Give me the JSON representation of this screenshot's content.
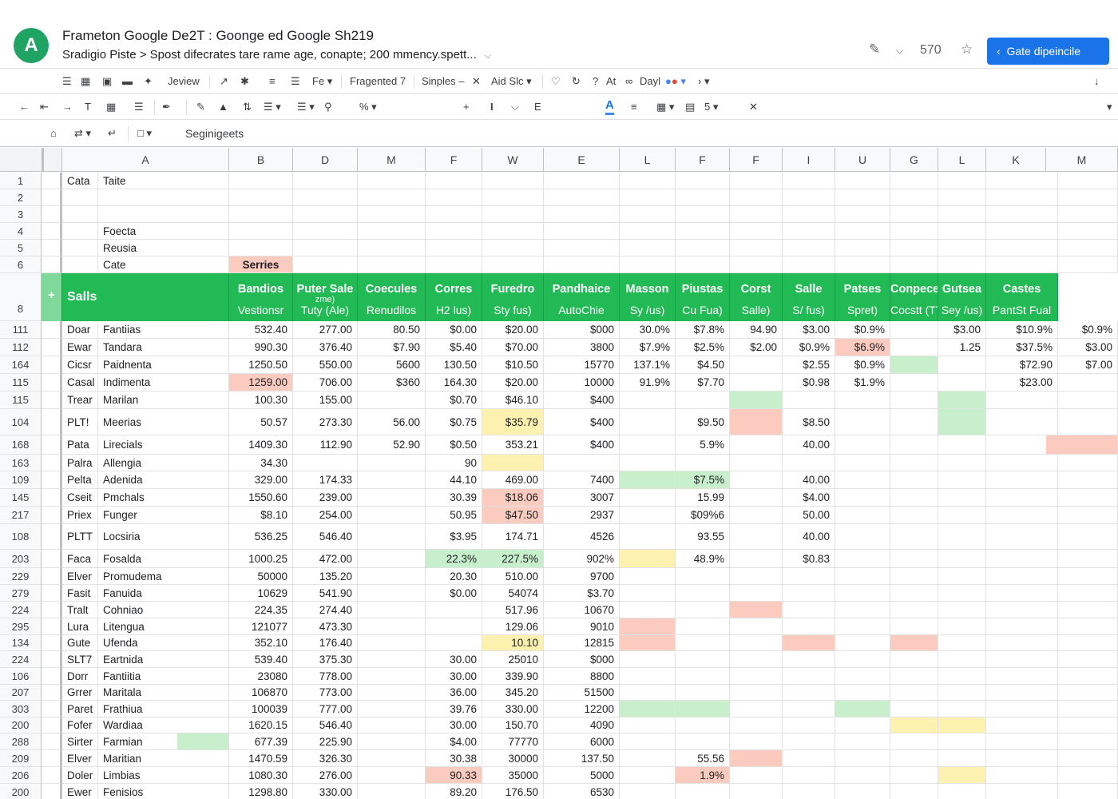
{
  "window": {
    "app_initial": "A",
    "title": "Frameton Google De2T : Goonge ed Google Sh219",
    "subtitle": "Sradigio Piste > Spost difecrates tare rame age, conapte; 200 mmency.spett...",
    "count": "570",
    "share_label": "Gate dipeincile",
    "accent": "#1a73e8",
    "brand": "#1fa463"
  },
  "toolbar1": {
    "review": "Jeview",
    "fe": "Fe",
    "fragmented": "Fragented 7",
    "simples": "Sinples",
    "aid": "Aid Slc",
    "at": "At",
    "day": "Dayl"
  },
  "toolbar2": {
    "font_i": "I",
    "font_e": "E",
    "font_a": "A",
    "num": "5"
  },
  "toolbar3": {
    "segment": "Seginigeets"
  },
  "columns": [
    "A",
    "B",
    "D",
    "M",
    "F",
    "W",
    "E",
    "L",
    "F",
    "F",
    "I",
    "U",
    "G",
    "L",
    "K",
    "M"
  ],
  "header_green": "#21ba55",
  "top_rows": [
    {
      "num": "1",
      "a": "Cata",
      "b": "Taite"
    },
    {
      "num": "2",
      "a": "",
      "b": ""
    },
    {
      "num": "3",
      "a": "",
      "b": ""
    },
    {
      "num": "4",
      "a": "",
      "b": "Foecta"
    },
    {
      "num": "5",
      "a": "",
      "b": "Reusia"
    },
    {
      "num": "6",
      "a": "",
      "b": "Cate",
      "series": "Serries"
    }
  ],
  "header_row": {
    "num": "8",
    "plus": "+",
    "first": "Salls",
    "cols": [
      {
        "l1": "Bandios",
        "l2": "Vestionsr"
      },
      {
        "l1": "Puter Sale",
        "sm": "zme)",
        "l2": "Tuty (Ale)"
      },
      {
        "l1": "Coecules",
        "l2": "Renudilos"
      },
      {
        "l1": "Corres",
        "l2": "H2 lus)"
      },
      {
        "l1": "Furedro",
        "l2": "Sty fus)"
      },
      {
        "l1": "Pandhaice",
        "l2": "AutoChie"
      },
      {
        "l1": "Masson",
        "l2": "Sy /us)"
      },
      {
        "l1": "Piustas",
        "l2": "Cu Fua)"
      },
      {
        "l1": "Corst",
        "l2": "Salle)"
      },
      {
        "l1": "Salle",
        "l2": "S/ fus)"
      },
      {
        "l1": "Patses",
        "l2": "Spret)"
      },
      {
        "l1": "Conpecetios",
        "l2": "Cocstt (TTe)"
      },
      {
        "l1": "Gutsea",
        "l2": "Sey /us)"
      },
      {
        "l1": "Castes",
        "l2": "PantSt Fual"
      }
    ]
  },
  "rows": [
    {
      "num": "111",
      "a": "Doar",
      "b": "Fantiias",
      "v": [
        "532.40",
        "277.00",
        "80.50",
        "$0.00",
        "$20.00",
        "$000",
        "30.0%",
        "$7.8%",
        "94.90",
        "$3.00",
        "$0.9%",
        "",
        "$3.00",
        "$10.9%",
        "$0.9%"
      ],
      "hl": {}
    },
    {
      "num": "112",
      "a": "Ewar",
      "b": "Tandara",
      "v": [
        "990.30",
        "376.40",
        "$7.90",
        "$5.40",
        "$70.00",
        "3800",
        "$7.9%",
        "$2.5%",
        "$2.00",
        "$0.9%",
        "$6.9%",
        "",
        "1.25",
        "$37.5%",
        "$3.00"
      ],
      "hl": {
        "10": "red"
      }
    },
    {
      "num": "164",
      "a": "Cicsr",
      "b": "Paidnenta",
      "v": [
        "1250.50",
        "550.00",
        "5600",
        "130.50",
        "$10.50",
        "15770",
        "137.1%",
        "$4.50",
        "",
        "$2.55",
        "$0.9%",
        "",
        "",
        "$72.90",
        "$7.00"
      ],
      "hl": {
        "11": "green"
      }
    },
    {
      "num": "115",
      "a": "Casal",
      "b": "Indimenta",
      "v": [
        "1259.00",
        "706.00",
        "$360",
        "164.30",
        "$20.00",
        "10000",
        "91.9%",
        "$7.70",
        "",
        "$0.98",
        "$1.9%",
        "",
        "",
        "$23.00",
        ""
      ],
      "hl": {
        "0": "red"
      }
    },
    {
      "num": "115",
      "a": "Trear",
      "b": "Marilan",
      "v": [
        "100.30",
        "155.00",
        "",
        "$0.70",
        "$46.10",
        "$400",
        "",
        "",
        "",
        "",
        "",
        "",
        "",
        "",
        ""
      ],
      "hl": {
        "8": "green",
        "12": "green"
      }
    },
    {
      "num": "104",
      "a": "PLT!",
      "b": "Meerias",
      "v": [
        "50.57",
        "273.30",
        "56.00",
        "$0.75",
        "$35.79",
        "$400",
        "",
        "$9.50",
        "",
        "$8.50",
        "",
        "",
        "",
        "",
        ""
      ],
      "hl": {
        "4": "yellow",
        "8": "red",
        "12": "green"
      }
    },
    {
      "num": "168",
      "a": "Pata",
      "b": "Lirecials",
      "v": [
        "1409.30",
        "112.90",
        "52.90",
        "$0.50",
        "353.21",
        "$400",
        "",
        "5.9%",
        "",
        "40.00",
        "",
        "",
        "",
        "",
        ""
      ],
      "hl": {
        "14": "red"
      }
    },
    {
      "num": "163",
      "a": "Palra",
      "b": "Allengia",
      "v": [
        "34.30",
        "",
        "",
        "90",
        "",
        "",
        "",
        "",
        "",
        "",
        "",
        "",
        "",
        "",
        ""
      ],
      "hl": {
        "4": "yellow"
      }
    },
    {
      "num": "109",
      "a": "Pelta",
      "b": "Adenida",
      "v": [
        "329.00",
        "174.33",
        "",
        "44.10",
        "469.00",
        "7400",
        "",
        "$7.5%",
        "",
        "40.00",
        "",
        "",
        "",
        "",
        ""
      ],
      "hl": {
        "6": "green",
        "7": "green"
      }
    },
    {
      "num": "145",
      "a": "Cseit",
      "b": "Pmchals",
      "v": [
        "1550.60",
        "239.00",
        "",
        "30.39",
        "$18.06",
        "3007",
        "",
        "15.99",
        "",
        "$4.00",
        "",
        "",
        "",
        "",
        ""
      ],
      "hl": {
        "4": "red"
      }
    },
    {
      "num": "217",
      "a": "Priex",
      "b": "Funger",
      "v": [
        "$8.10",
        "254.00",
        "",
        "50.95",
        "$47.50",
        "2937",
        "",
        "$09%6",
        "",
        "50.00",
        "",
        "",
        "",
        "",
        ""
      ],
      "hl": {
        "4": "red"
      }
    },
    {
      "num": "108",
      "a": "PLTT",
      "b": "Locsiria",
      "v": [
        "536.25",
        "546.40",
        "",
        "$3.95",
        "174.71",
        "4526",
        "",
        "93.55",
        "",
        "40.00",
        "",
        "",
        "",
        "",
        ""
      ],
      "hl": {}
    },
    {
      "num": "203",
      "a": "Faca",
      "b": "Fosalda",
      "v": [
        "1000.25",
        "472.00",
        "",
        "22.3%",
        "227.5%",
        "902%",
        "",
        "48.9%",
        "",
        "$0.83",
        "",
        "",
        "",
        "",
        ""
      ],
      "hl": {
        "3": "green",
        "4": "green",
        "6": "yellow"
      }
    },
    {
      "num": "229",
      "a": "Elver",
      "b": "Promudema",
      "v": [
        "50000",
        "135.20",
        "",
        "20.30",
        "510.00",
        "9700",
        "",
        "",
        "",
        "",
        "",
        "",
        "",
        "",
        ""
      ],
      "hl": {}
    },
    {
      "num": "279",
      "a": "Fasit",
      "b": "Fanuida",
      "v": [
        "10629",
        "541.90",
        "",
        "$0.00",
        "54074",
        "$3.70",
        "",
        "",
        "",
        "",
        "",
        "",
        "",
        "",
        ""
      ],
      "hl": {}
    },
    {
      "num": "224",
      "a": "Tralt",
      "b": "Cohniao",
      "v": [
        "224.35",
        "274.40",
        "",
        "",
        "517.96",
        "10670",
        "",
        "",
        "",
        "",
        "",
        "",
        "",
        "",
        ""
      ],
      "hl": {
        "8": "red"
      }
    },
    {
      "num": "295",
      "a": "Lura",
      "b": "Litengua",
      "v": [
        "121077",
        "473.30",
        "",
        "",
        "129.06",
        "9010",
        "",
        "",
        "",
        "",
        "",
        "",
        "",
        "",
        ""
      ],
      "hl": {
        "6": "red"
      }
    },
    {
      "num": "134",
      "a": "Gute",
      "b": "Ufenda",
      "v": [
        "352.10",
        "176.40",
        "",
        "",
        "10.10",
        "12815",
        "",
        "",
        "",
        "",
        "",
        "",
        "",
        "",
        ""
      ],
      "hl": {
        "4": "yellow",
        "6": "red",
        "9": "red",
        "11": "red"
      }
    },
    {
      "num": "224",
      "a": "SLT7",
      "b": "Eartnida",
      "v": [
        "539.40",
        "375.30",
        "",
        "30.00",
        "25010",
        "$000",
        "",
        "",
        "",
        "",
        "",
        "",
        "",
        "",
        ""
      ],
      "hl": {}
    },
    {
      "num": "106",
      "a": "Dorr",
      "b": "Fantiitia",
      "v": [
        "23080",
        "778.00",
        "",
        "30.00",
        "339.90",
        "8800",
        "",
        "",
        "",
        "",
        "",
        "",
        "",
        "",
        ""
      ],
      "hl": {}
    },
    {
      "num": "207",
      "a": "Grrer",
      "b": "Maritala",
      "v": [
        "106870",
        "773.00",
        "",
        "36.00",
        "345.20",
        "51500",
        "",
        "",
        "",
        "",
        "",
        "",
        "",
        "",
        ""
      ],
      "hl": {}
    },
    {
      "num": "303",
      "a": "Paret",
      "b": "Frathiua",
      "v": [
        "100039",
        "777.00",
        "",
        "39.76",
        "330.00",
        "12200",
        "",
        "",
        "",
        "",
        "",
        "",
        "",
        "",
        ""
      ],
      "hl": {
        "6": "green",
        "7": "green",
        "10": "green"
      }
    },
    {
      "num": "200",
      "a": "Fofer",
      "b": "Wardiaa",
      "v": [
        "1620.15",
        "546.40",
        "",
        "30.00",
        "150.70",
        "4090",
        "",
        "",
        "",
        "",
        "",
        "",
        "",
        "",
        ""
      ],
      "hl": {
        "11": "yellow",
        "12": "yellow"
      }
    },
    {
      "num": "288",
      "a": "Sirter",
      "b": "Farmian",
      "v": [
        "677.39",
        "225.90",
        "",
        "$4.00",
        "77770",
        "6000",
        "",
        "",
        "",
        "",
        "",
        "",
        "",
        "",
        ""
      ],
      "hl": {
        "b": "green"
      }
    },
    {
      "num": "209",
      "a": "Elver",
      "b": "Maritian",
      "v": [
        "1470.59",
        "326.30",
        "",
        "30.38",
        "30000",
        "137.50",
        "",
        "55.56",
        "",
        "",
        "",
        "",
        "",
        "",
        ""
      ],
      "hl": {
        "8": "red"
      }
    },
    {
      "num": "206",
      "a": "Doler",
      "b": "Limbias",
      "v": [
        "1080.30",
        "276.00",
        "",
        "90.33",
        "35000",
        "5000",
        "",
        "1.9%",
        "",
        "",
        "",
        "",
        "",
        "",
        ""
      ],
      "hl": {
        "3": "red",
        "7": "red",
        "12": "yellow"
      }
    },
    {
      "num": "200",
      "a": "Ewer",
      "b": "Fenisios",
      "v": [
        "1298.80",
        "330.00",
        "",
        "89.20",
        "176.50",
        "6530",
        "",
        "",
        "",
        "",
        "",
        "",
        "",
        "",
        ""
      ],
      "hl": {}
    }
  ]
}
